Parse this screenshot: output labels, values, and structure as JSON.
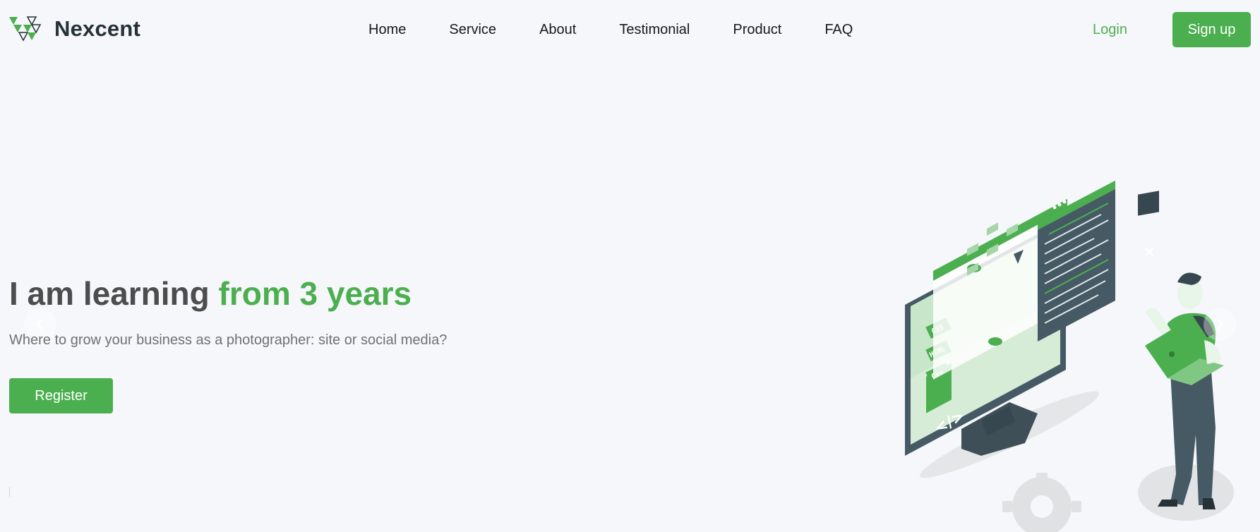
{
  "brand": {
    "name": "Nexcent"
  },
  "nav": {
    "items": [
      {
        "label": "Home"
      },
      {
        "label": "Service"
      },
      {
        "label": "About"
      },
      {
        "label": "Testimonial"
      },
      {
        "label": "Product"
      },
      {
        "label": "FAQ"
      }
    ]
  },
  "auth": {
    "login_label": "Login",
    "signup_label": "Sign up"
  },
  "hero": {
    "title_main": "I am learning ",
    "title_accent": "from 3 years",
    "subtitle": "Where to grow your business as a photographer: site or social media?",
    "cta_label": "Register",
    "illustration_labels": {
      "css": "CSS",
      "html": "HTML",
      "cpp": "C++"
    }
  },
  "icons": {
    "logo": "nexcent-logo-icon",
    "prev": "chevron-left-icon",
    "next": "chevron-right-icon"
  },
  "colors": {
    "primary": "#4caf4f",
    "background": "#f5f7fa",
    "heading": "#4d4d4d",
    "text": "#717171",
    "dark": "#263238"
  }
}
